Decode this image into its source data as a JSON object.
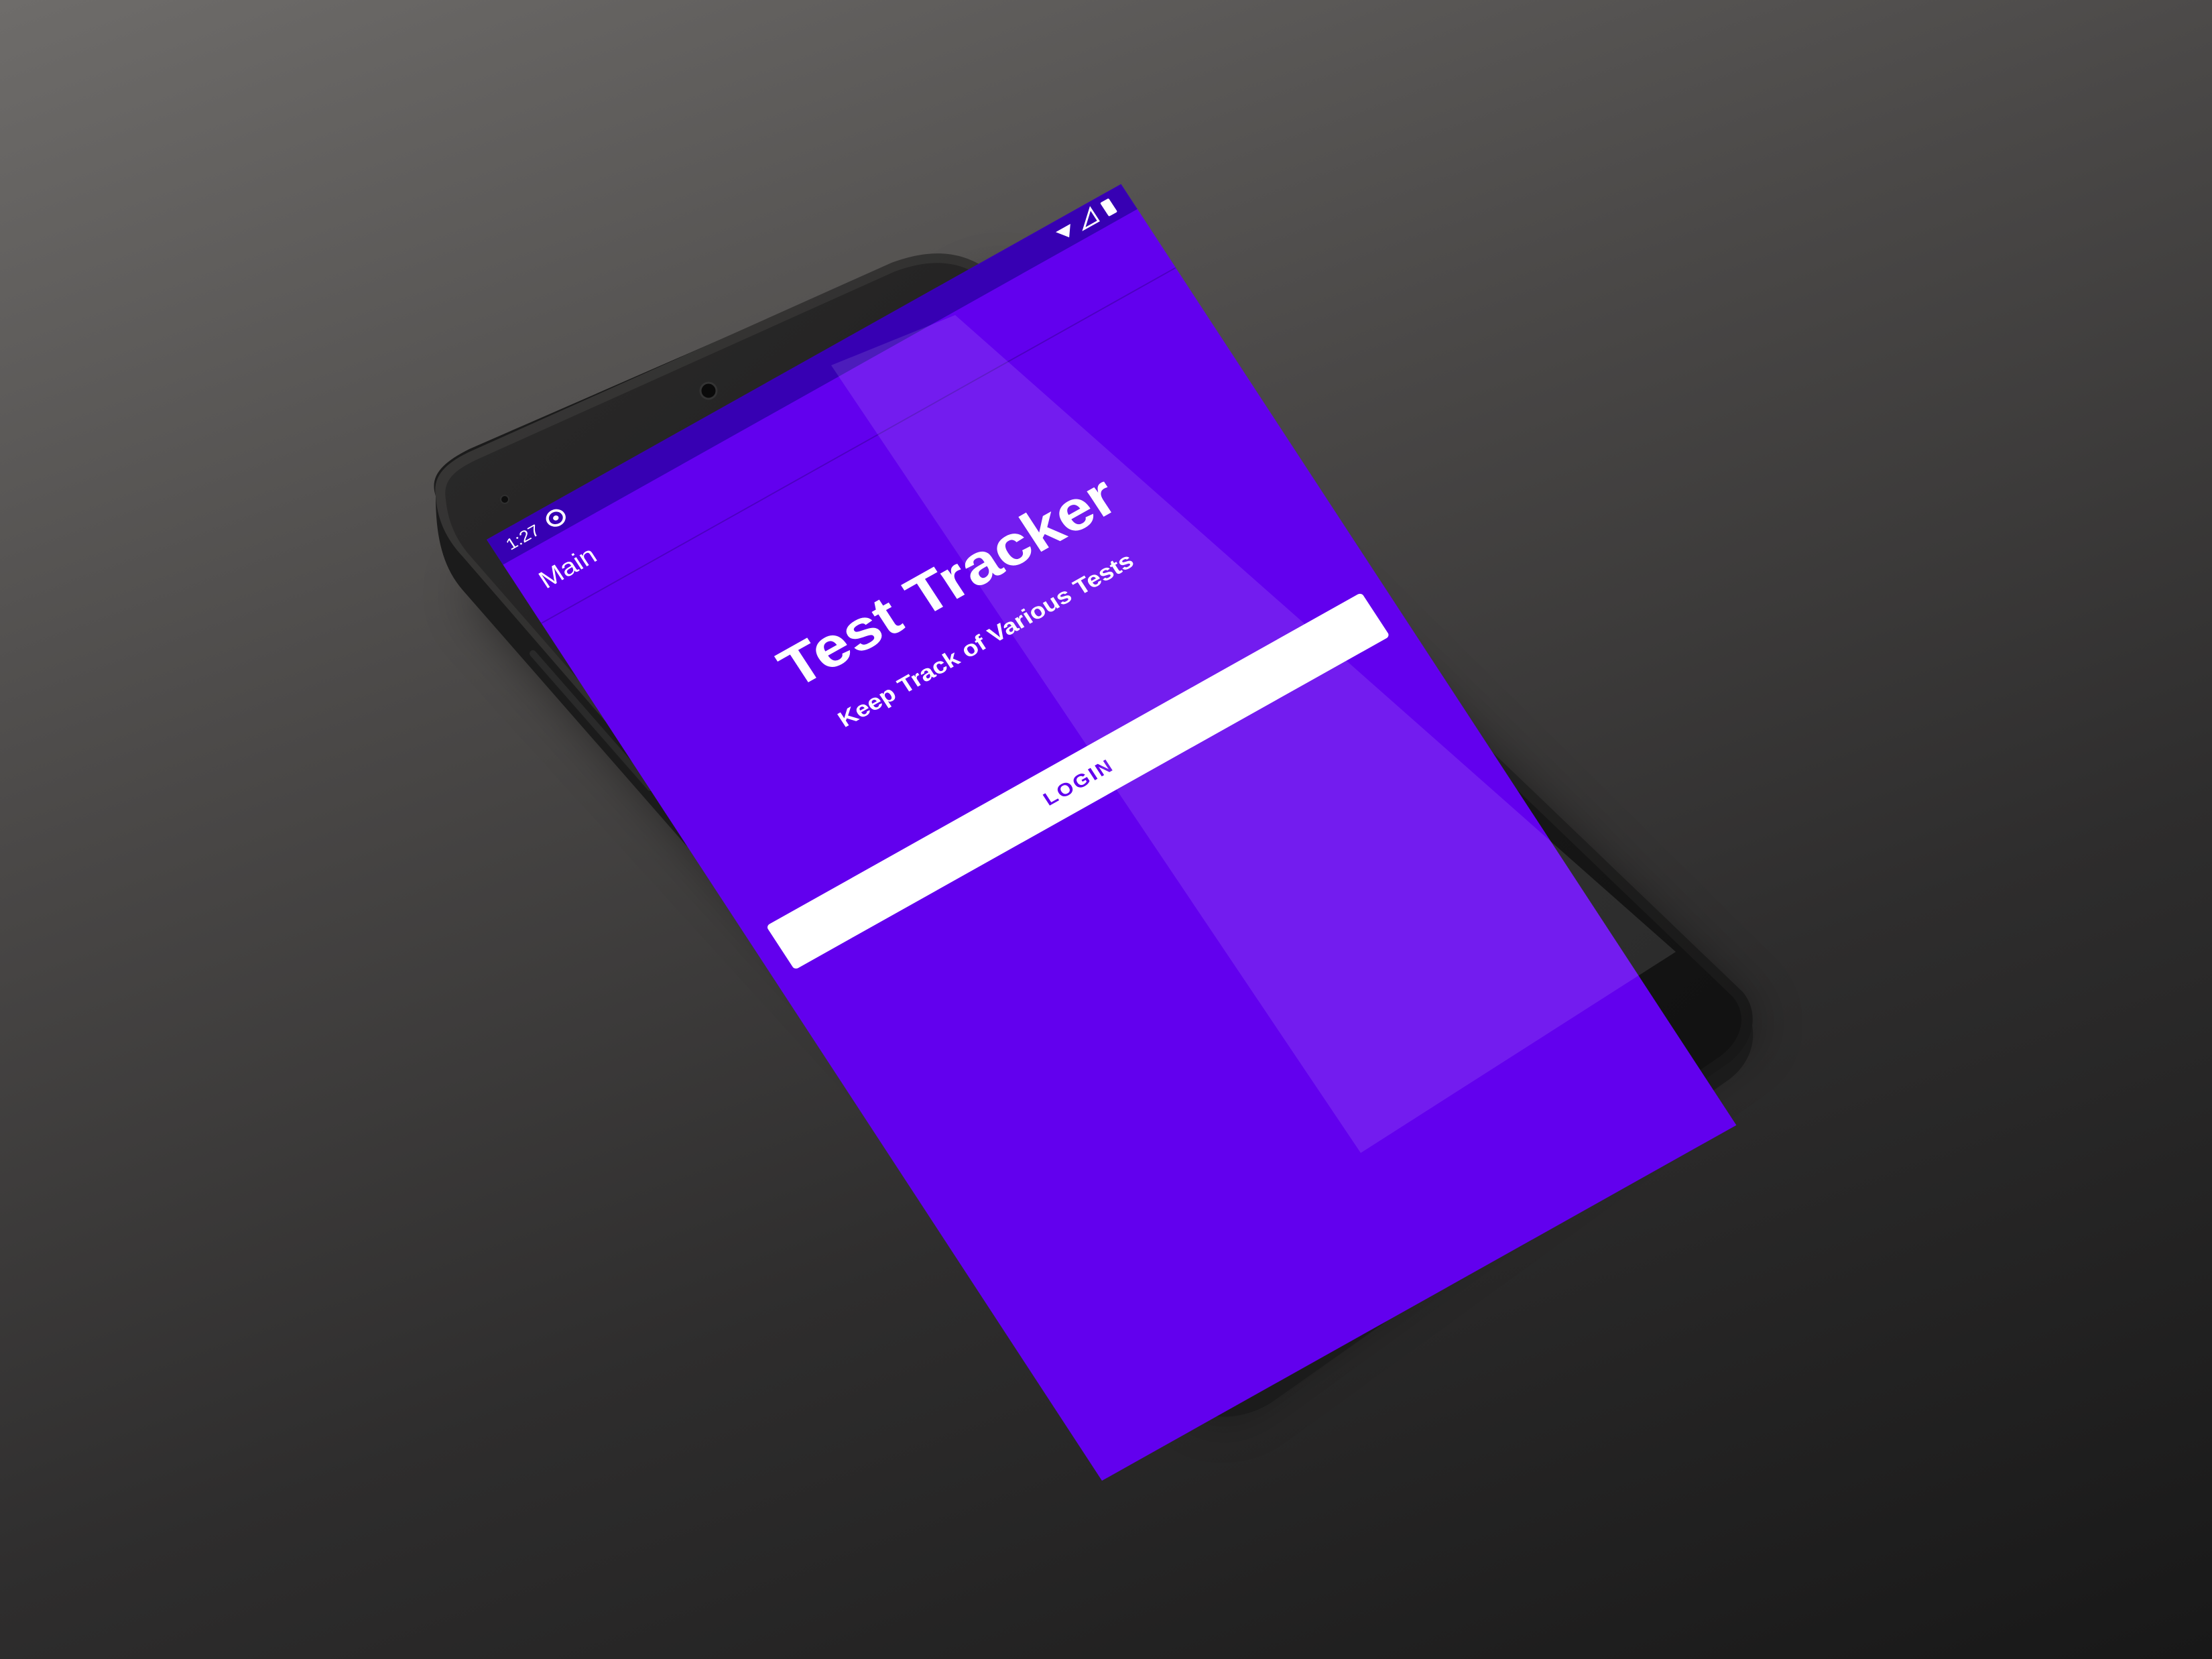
{
  "status_bar": {
    "time": "1:27",
    "notification_icon": "data-saver-icon",
    "right_icons": [
      "wifi-icon",
      "signal-icon",
      "battery-icon"
    ]
  },
  "app_bar": {
    "title": "Main"
  },
  "main": {
    "title": "Test Tracker",
    "subtitle": "Keep Track of Various Tests",
    "login_label": "LOGIN"
  },
  "colors": {
    "primary": "#6200EE",
    "primary_dark": "#3700B3",
    "button_bg": "#FFFFFF",
    "button_text": "#6200EE",
    "text_on_primary": "#FFFFFF"
  }
}
